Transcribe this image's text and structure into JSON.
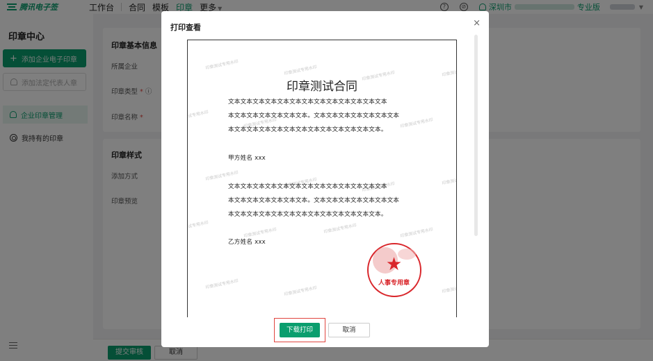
{
  "topbar": {
    "logo_text": "腾讯电子签",
    "nav": [
      {
        "label": "工作台",
        "active": false
      },
      {
        "label": "合同",
        "active": false
      },
      {
        "label": "模板",
        "active": false
      },
      {
        "label": "印章",
        "active": true
      },
      {
        "label": "更多",
        "active": false
      }
    ],
    "help_icon": "help-icon",
    "settings_icon": "compass-icon",
    "company_prefix": "深圳市",
    "edition": "专业版"
  },
  "sidebar": {
    "title": "印章中心",
    "add_button": "添加企业电子印章",
    "legal_button": "添加法定代表人章",
    "items": [
      {
        "label": "企业印章管理",
        "active": true
      },
      {
        "label": "我持有的印章",
        "active": false
      }
    ]
  },
  "form": {
    "basic_title": "印章基本信息",
    "company_label": "所属企业",
    "type_label": "印章类型",
    "name_label": "印章名称",
    "style_title": "印章样式",
    "method_label": "添加方式",
    "preview_label": "印章预览",
    "required_mark": "*",
    "info_icon": "ⓘ"
  },
  "footer": {
    "submit": "提交审核",
    "cancel": "取消"
  },
  "modal": {
    "title": "打印查看",
    "close": "×",
    "watermark": "印章测试专用水印",
    "document": {
      "title": "印章测试合同",
      "lines": [
        "文本文本文本文本文本文本文本文本文本文本文本文本文本",
        "本文本文本文本文本文本文本。文本文本文本文本文本文本文本",
        "本文本文本文本文本文本文本文本文本文本文本文本文本。",
        "甲方姓名 xxx",
        "文本文本文本文本文本文本文本文本文本文本文本文本文本",
        "本文本文本文本文本文本文本。文本文本文本文本文本文本文本",
        "本文本文本文本文本文本文本文本文本文本文本文本文本。",
        "乙方姓名 xxx"
      ],
      "stamp_text": "人事专用章",
      "stamp_color": "#d9262b"
    },
    "download_button": "下载打印",
    "cancel_button": "取消"
  },
  "colors": {
    "brand": "#0a9e6e",
    "highlight_border": "#e0443e"
  }
}
